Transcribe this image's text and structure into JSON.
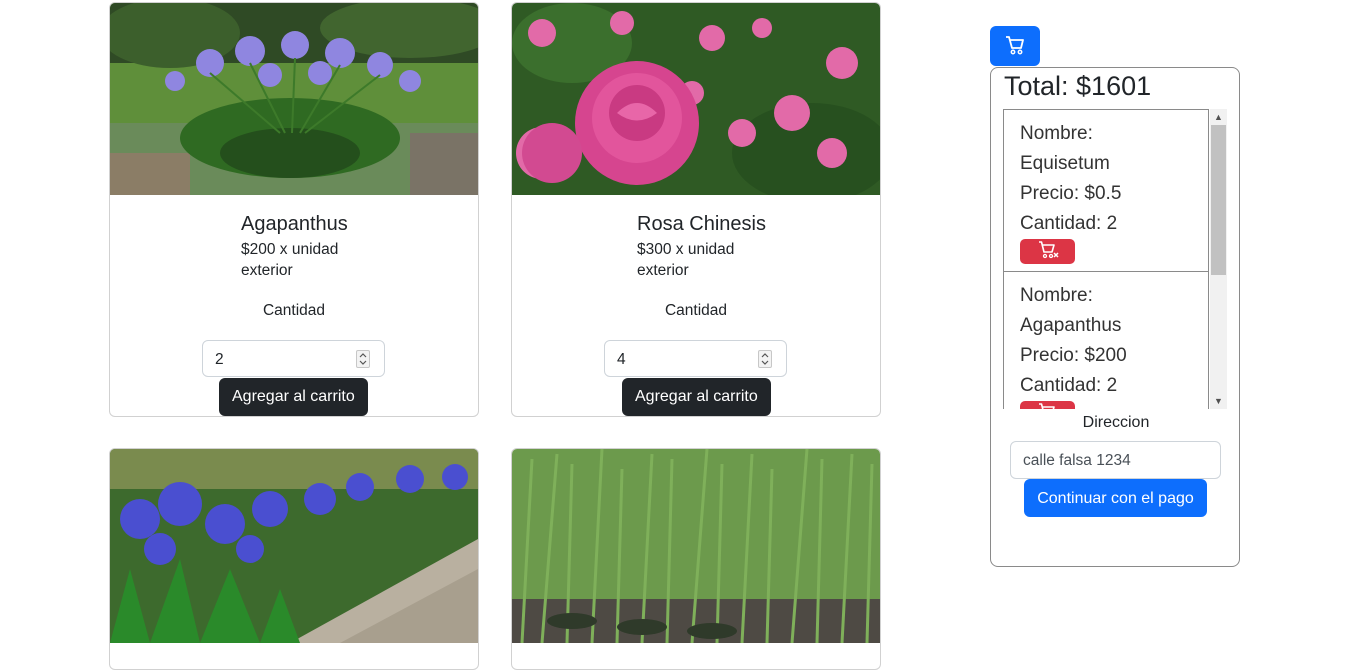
{
  "products": [
    {
      "name": "Agapanthus",
      "price": "$200 x unidad",
      "category": "exterior",
      "qty_label": "Cantidad",
      "qty": "2",
      "add_label": "Agregar al carrito"
    },
    {
      "name": "Rosa Chinesis",
      "price": "$300 x unidad",
      "category": "exterior",
      "qty_label": "Cantidad",
      "qty": "4",
      "add_label": "Agregar al carrito"
    }
  ],
  "cart": {
    "toggle_icon": "shopping-cart-icon",
    "total": "Total: $1601",
    "items": [
      {
        "name_label": "Nombre:",
        "name": "Equisetum",
        "price": "Precio: $0.5",
        "qty": "Cantidad: 2",
        "remove_icon": "cart-x-icon"
      },
      {
        "name_label": "Nombre:",
        "name": "Agapanthus",
        "price": "Precio: $200",
        "qty": "Cantidad: 2",
        "remove_icon": "cart-x-icon"
      }
    ],
    "address_label": "Direccion",
    "address_value": "calle falsa 1234",
    "pay_label": "Continuar con el pago"
  },
  "colors": {
    "primary": "#0d6efd",
    "danger": "#dc3545",
    "dark": "#212529"
  }
}
